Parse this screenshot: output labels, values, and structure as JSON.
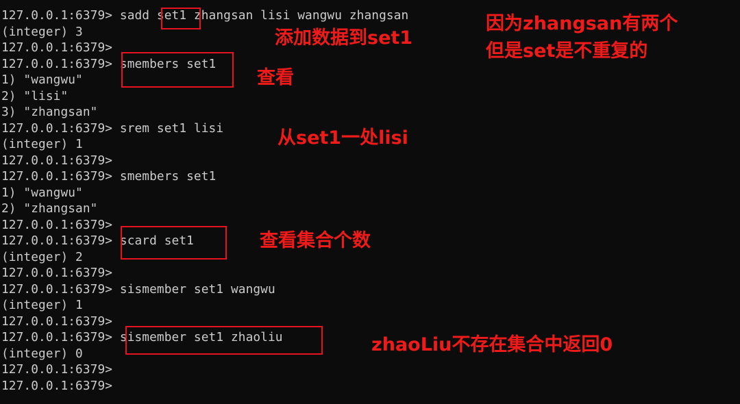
{
  "terminal": {
    "lines": [
      "127.0.0.1:6379> sadd set1 zhangsan lisi wangwu zhangsan",
      "(integer) 3",
      "127.0.0.1:6379>",
      "127.0.0.1:6379> smembers set1",
      "1) \"wangwu\"",
      "2) \"lisi\"",
      "3) \"zhangsan\"",
      "127.0.0.1:6379> srem set1 lisi",
      "(integer) 1",
      "127.0.0.1:6379>",
      "127.0.0.1:6379> smembers set1",
      "1) \"wangwu\"",
      "2) \"zhangsan\"",
      "127.0.0.1:6379>",
      "127.0.0.1:6379> scard set1",
      "(integer) 2",
      "127.0.0.1:6379>",
      "127.0.0.1:6379> sismember set1 wangwu",
      "(integer) 1",
      "127.0.0.1:6379>",
      "127.0.0.1:6379> sismember set1 zhaoliu",
      "(integer) 0",
      "127.0.0.1:6379>",
      "127.0.0.1:6379>"
    ]
  },
  "annotations": {
    "add_to_set": "添加数据到set1",
    "duplicate_note_line1": "因为zhangsan有两个",
    "duplicate_note_line2": "但是set是不重复的",
    "view": "查看",
    "remove_lisi": "从set1一处lisi",
    "view_count": "查看集合个数",
    "zhaoliu_not_in_set": "zhaoLiu不存在集合中返回0"
  },
  "colors": {
    "background": "#0c0c0c",
    "terminal_text": "#cccccc",
    "annotation_red": "#ef1a1a"
  }
}
